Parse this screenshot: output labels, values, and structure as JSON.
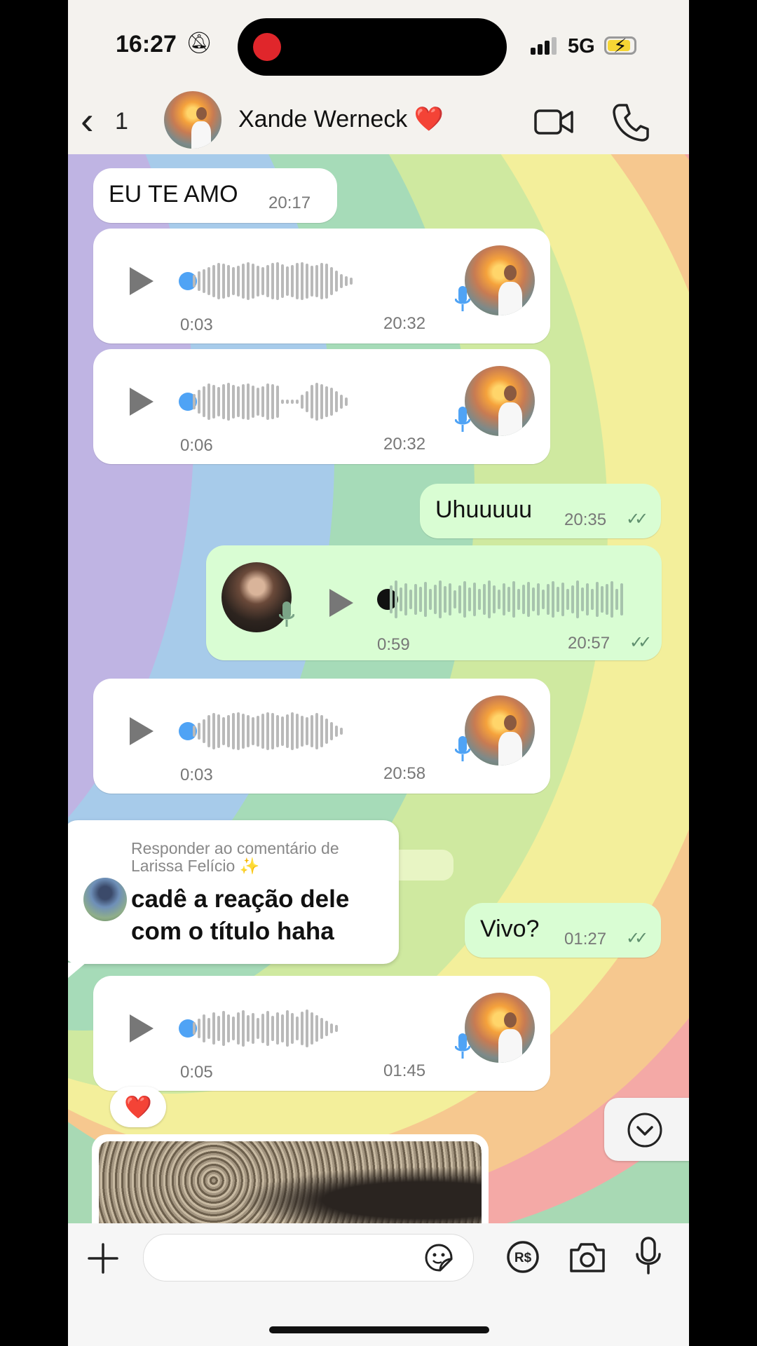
{
  "status_bar": {
    "time": "16:27",
    "network": "5G",
    "silent_icon": "bell-slash-icon",
    "battery_color": "#f6d634"
  },
  "header": {
    "back_count": "1",
    "contact_name": "Xande Werneck",
    "contact_emoji": "❤️"
  },
  "messages": [
    {
      "kind": "text",
      "direction": "in",
      "text": "EU TE AMO",
      "time": "20:17"
    },
    {
      "kind": "voice",
      "direction": "in",
      "duration": "0:03",
      "time": "20:32"
    },
    {
      "kind": "voice",
      "direction": "in",
      "duration": "0:06",
      "time": "20:32"
    },
    {
      "kind": "text",
      "direction": "out",
      "text": "Uhuuuuu",
      "time": "20:35",
      "status": "read"
    },
    {
      "kind": "voice",
      "direction": "out",
      "duration": "0:59",
      "time": "20:57",
      "status": "read"
    },
    {
      "kind": "voice",
      "direction": "in",
      "duration": "0:03",
      "time": "20:58"
    },
    {
      "kind": "text",
      "direction": "out",
      "text": "Vivo?",
      "time": "01:27",
      "status": "read"
    },
    {
      "kind": "voice",
      "direction": "in",
      "duration": "0:05",
      "time": "01:45"
    }
  ],
  "reply_overlay": {
    "heading_line1": "Responder ao comentário de",
    "heading_line2": "Larissa Felício ✨",
    "comment_line1": "cadê a reação dele",
    "comment_line2": "com o título haha"
  },
  "reaction": "❤️",
  "colors": {
    "incoming": "#ffffff",
    "outgoing": "#d9fdd3",
    "read_ticks": "#5f8f6e",
    "voice_dot": "#4fa3f5"
  }
}
